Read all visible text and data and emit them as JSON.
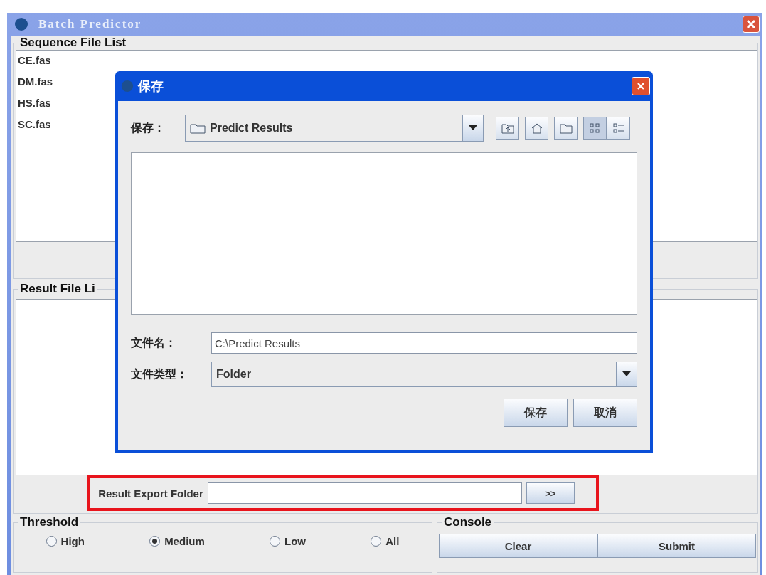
{
  "window": {
    "title": "Batch Predictor"
  },
  "sequence_file_list": {
    "title": "Sequence File List",
    "items": [
      "CE.fas",
      "DM.fas",
      "HS.fas",
      "SC.fas"
    ]
  },
  "result_file_list": {
    "title": "Result File Li"
  },
  "export": {
    "label": "Result Export Folder",
    "browse_button": ">>",
    "highlighted": true
  },
  "threshold": {
    "title": "Threshold",
    "options": [
      {
        "label": "High",
        "selected": false
      },
      {
        "label": "Medium",
        "selected": true
      },
      {
        "label": "Low",
        "selected": false
      },
      {
        "label": "All",
        "selected": false
      }
    ]
  },
  "console": {
    "title": "Console",
    "buttons": [
      "Clear",
      "Submit"
    ]
  },
  "dialog": {
    "title": "保存",
    "save_in_label": "保存：",
    "save_in_value": "Predict Results",
    "tools": [
      {
        "kind": "up",
        "selected": false
      },
      {
        "kind": "home",
        "selected": false
      },
      {
        "kind": "newfolder",
        "selected": false
      },
      {
        "kind": "list",
        "selected": true
      },
      {
        "kind": "details",
        "selected": false
      }
    ],
    "file_name_label": "文件名：",
    "file_name": "C:\\Predict Results",
    "file_type_label": "文件类型：",
    "file_type": "Folder",
    "buttons": [
      "保存",
      "取消"
    ]
  }
}
